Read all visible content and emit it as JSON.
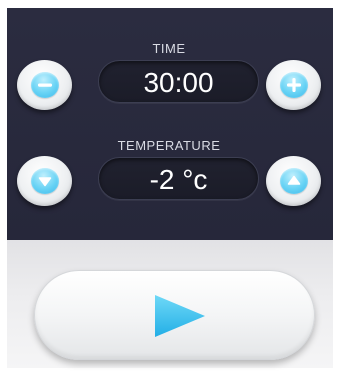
{
  "time": {
    "label": "TIME",
    "value": "30:00"
  },
  "temperature": {
    "label": "TEMPERATURE",
    "value": "-2 °c"
  },
  "icons": {
    "time_decrease": "minus-icon",
    "time_increase": "plus-icon",
    "temperature_decrease": "arrow-down-icon",
    "temperature_increase": "arrow-up-icon",
    "start": "play-icon"
  },
  "colors": {
    "panel_background": "#2b2c40",
    "accent": "#3cc3f0",
    "display_text": "#ffffff"
  }
}
